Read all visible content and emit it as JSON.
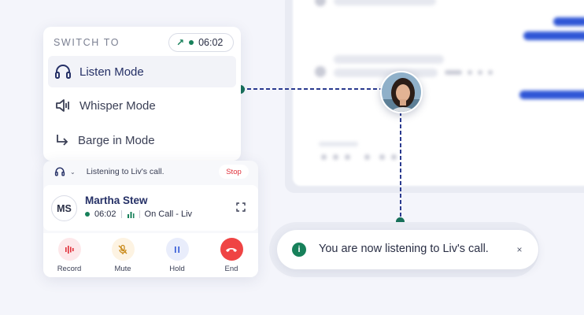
{
  "switch_menu": {
    "title": "SWITCH TO",
    "timer": "06:02",
    "items": [
      {
        "label": "Listen Mode",
        "icon": "headset-icon",
        "active": true
      },
      {
        "label": "Whisper Mode",
        "icon": "speaker-icon",
        "active": false
      },
      {
        "label": "Barge in Mode",
        "icon": "arrow-turn-right-icon",
        "active": false
      }
    ]
  },
  "listen_bar": {
    "text": "Listening to Liv's call.",
    "stop_label": "Stop"
  },
  "contact": {
    "initials": "MS",
    "name": "Martha Stew",
    "duration": "06:02",
    "status": "On Call - Liv"
  },
  "actions": [
    {
      "label": "Record",
      "icon": "record-icon",
      "color": "#e0303a",
      "bg": "#fde8ea"
    },
    {
      "label": "Mute",
      "icon": "mic-off-icon",
      "color": "#c98a1a",
      "bg": "#fdf3e2"
    },
    {
      "label": "Hold",
      "icon": "pause-icon",
      "color": "#2f56d6",
      "bg": "#e9edfb"
    },
    {
      "label": "End",
      "icon": "phone-hangup-icon",
      "color": "#ffffff",
      "bg": "#ef4444"
    }
  ],
  "toast": {
    "message": "You are now listening to Liv's call."
  },
  "colors": {
    "accent_green": "#17805a",
    "connector_blue": "#2a3a8f",
    "brand_blue": "#2f56d6"
  }
}
